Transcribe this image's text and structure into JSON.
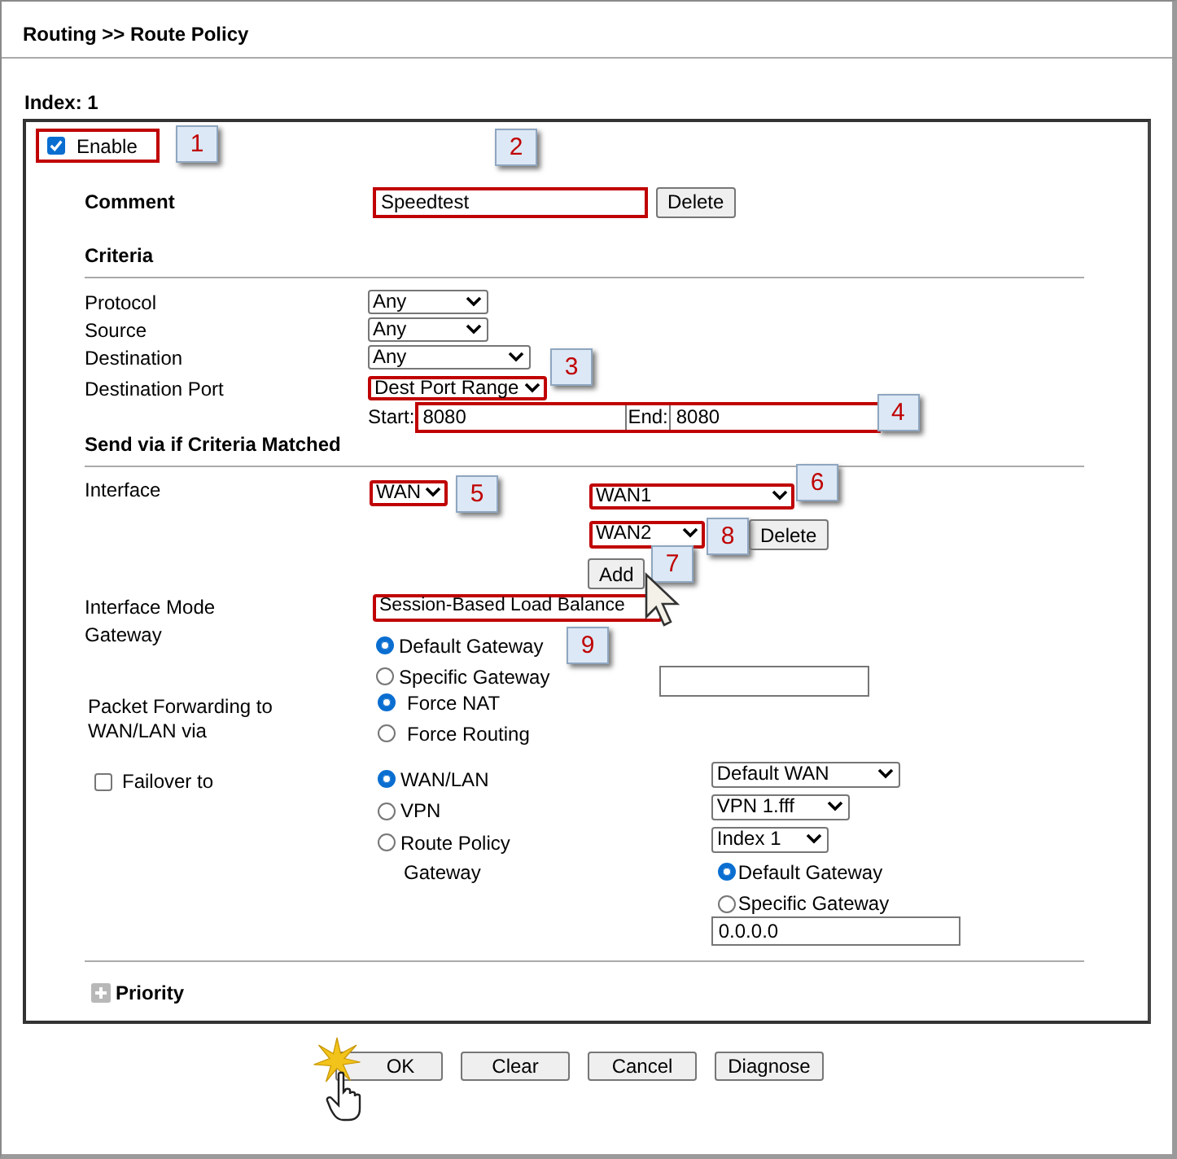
{
  "header": {
    "title": "Routing >> Route Policy"
  },
  "index_label": "Index: 1",
  "enable": {
    "label": "Enable",
    "checked": true,
    "highlighted": true,
    "callout": "1"
  },
  "comment": {
    "label": "Comment",
    "value": "Speedtest",
    "highlighted": true,
    "callout": "2",
    "button": "Delete"
  },
  "criteria": {
    "heading": "Criteria",
    "rows": [
      {
        "label": "Protocol",
        "value": "Any",
        "highlighted": false
      },
      {
        "label": "Source",
        "value": "Any",
        "highlighted": false
      },
      {
        "label": "Destination",
        "value": "Any",
        "highlighted": false
      },
      {
        "label": "Destination Port",
        "value": "Dest Port Range",
        "highlighted": true,
        "callout": "3"
      }
    ],
    "port_range": {
      "start_label": "Start:",
      "start": "8080",
      "end_label": "End:",
      "end": "8080",
      "highlighted": true,
      "callout": "4"
    }
  },
  "send_via": {
    "heading": "Send via if Criteria Matched",
    "interface": {
      "label": "Interface",
      "type": {
        "value": "WAN",
        "highlighted": true,
        "callout": "5"
      },
      "members": [
        {
          "value": "WAN1",
          "highlighted": true,
          "callout": "6"
        },
        {
          "value": "WAN2",
          "highlighted": true,
          "callout": "8",
          "button": "Delete"
        }
      ],
      "add_button": "Add",
      "add_callout": "7"
    },
    "mode": {
      "label": "Interface Mode",
      "value": "Session-Based Load Balance",
      "highlighted": true
    },
    "gateway": {
      "label": "Gateway",
      "callout": "9",
      "options": [
        {
          "label": "Default Gateway",
          "selected": true
        },
        {
          "label": "Specific Gateway",
          "selected": false
        }
      ]
    },
    "forwarding": {
      "label_lines": [
        "Packet Forwarding to",
        "WAN/LAN via"
      ],
      "options": [
        {
          "label": "Force NAT",
          "selected": true
        },
        {
          "label": "Force Routing",
          "selected": false
        }
      ]
    },
    "failover": {
      "label": "Failover to",
      "checked": false,
      "options": [
        {
          "label": "WAN/LAN",
          "selected": true,
          "select": "Default WAN"
        },
        {
          "label": "VPN",
          "selected": false,
          "select": "VPN 1.fff"
        },
        {
          "label": "Route Policy",
          "selected": false,
          "select": "Index 1"
        }
      ],
      "gateway_label": "Gateway",
      "gateway_options": [
        {
          "label": "Default Gateway",
          "selected": true
        },
        {
          "label": "Specific Gateway",
          "selected": false
        }
      ],
      "gateway_ip": "0.0.0.0"
    }
  },
  "priority": {
    "label": "Priority",
    "expanded": false
  },
  "buttons": [
    "OK",
    "Clear",
    "Cancel",
    "Diagnose"
  ]
}
